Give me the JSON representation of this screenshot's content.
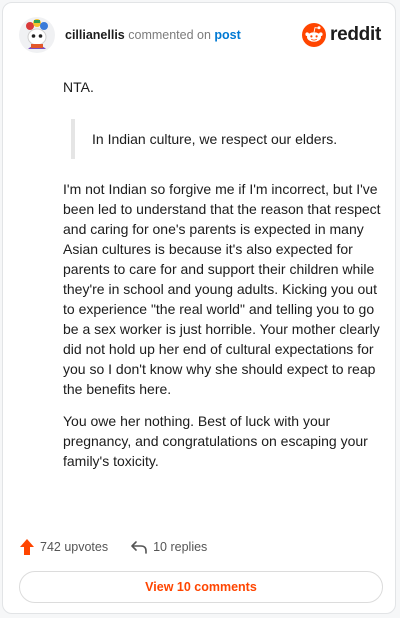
{
  "header": {
    "username": "cillianellis",
    "verb": " commented on ",
    "target": "post",
    "logo_text": "reddit"
  },
  "comment": {
    "opening": "NTA.",
    "quote": "In Indian culture, we respect our elders.",
    "paragraph1": "I'm not Indian so forgive me if I'm incorrect, but I've been led to understand that the reason that respect and caring for one's parents is expected in many Asian cultures is because it's also expected for parents to care for and support their children while they're in school and young adults. Kicking you out to experience \"the real world\" and telling you to go be a sex worker is just horrible. Your mother clearly did not hold up her end of cultural expectations for you so I don't know why she should expect to reap the benefits here.",
    "paragraph2": "You owe her nothing. Best of luck with your pregnancy, and congratulations on escaping your family's toxicity."
  },
  "actions": {
    "upvotes": "742 upvotes",
    "replies": "10 replies",
    "upvote_icon": "upvote-arrow-icon",
    "reply_icon": "reply-arrow-icon"
  },
  "view_button": {
    "label": "View 10 comments"
  },
  "colors": {
    "accent": "#ff4500",
    "link": "#0079d3"
  }
}
